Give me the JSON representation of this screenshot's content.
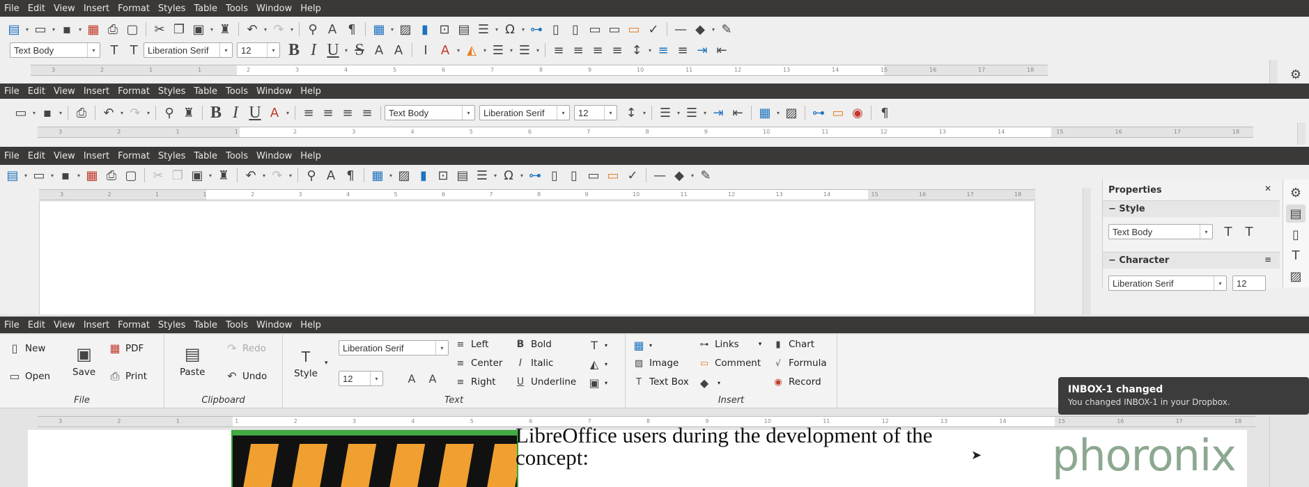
{
  "menu": [
    "File",
    "Edit",
    "View",
    "Insert",
    "Format",
    "Styles",
    "Table",
    "Tools",
    "Window",
    "Help"
  ],
  "band1": {
    "style": "Text Body",
    "font": "Liberation Serif",
    "size": "12",
    "ruler_nums": [
      "3",
      "2",
      "1",
      "1",
      "2",
      "3",
      "4",
      "5",
      "6",
      "7",
      "8",
      "9",
      "10",
      "11",
      "12",
      "13",
      "14",
      "15",
      "16",
      "17",
      "18"
    ]
  },
  "band2": {
    "style": "Text Body",
    "font": "Liberation Serif",
    "size": "12",
    "ruler_nums": [
      "3",
      "2",
      "1",
      "1",
      "2",
      "3",
      "4",
      "5",
      "6",
      "7",
      "8",
      "9",
      "10",
      "11",
      "12",
      "13",
      "14",
      "15",
      "16",
      "17",
      "18"
    ]
  },
  "band3": {
    "ruler_nums": [
      "3",
      "2",
      "1",
      "1",
      "2",
      "3",
      "4",
      "5",
      "6",
      "7",
      "8",
      "9",
      "10",
      "11",
      "12",
      "13",
      "14",
      "15",
      "16",
      "17",
      "18"
    ]
  },
  "sidebar": {
    "title": "Properties",
    "style_section": "Style",
    "style_value": "Text Body",
    "character_section": "Character",
    "font_value": "Liberation Serif",
    "size_value": "12"
  },
  "notebookbar": {
    "file": {
      "new": "New",
      "open": "Open",
      "save": "Save",
      "pdf": "PDF",
      "print": "Print",
      "label": "File"
    },
    "clipboard": {
      "paste": "Paste",
      "redo": "Redo",
      "undo": "Undo",
      "label": "Clipboard"
    },
    "text": {
      "style": "Style",
      "font": "Liberation Serif",
      "size": "12",
      "left": "Left",
      "center": "Center",
      "right": "Right",
      "bold": "Bold",
      "italic": "Italic",
      "underline": "Underline",
      "label": "Text"
    },
    "insert": {
      "image": "Image",
      "text_box": "Text Box",
      "links": "Links",
      "comment": "Comment",
      "chart": "Chart",
      "formula": "Formula",
      "record": "Record",
      "label": "Insert"
    }
  },
  "document": {
    "line1": "LibreOffice users during the development of the",
    "line2": "concept:"
  },
  "notification": {
    "title": "INBOX-1 changed",
    "body": "You changed INBOX-1 in your Dropbox."
  },
  "watermark": "phoronix",
  "colors": {
    "menubar": "#3a3937",
    "accent": "#1e73be",
    "toolbar_bg": "#efefef",
    "watermark": "#7a9a7e"
  }
}
